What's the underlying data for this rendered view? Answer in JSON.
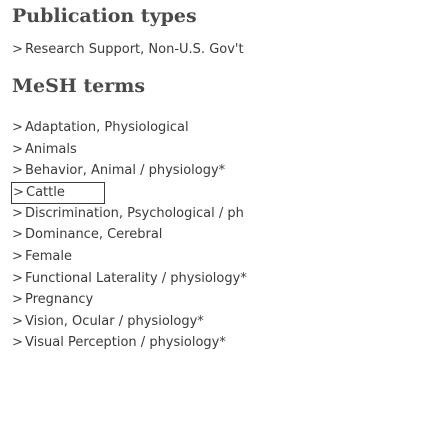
{
  "publication_types": {
    "heading": "Publication types",
    "items": [
      {
        "label": "Research Support, Non-U.S. Gov't"
      }
    ]
  },
  "mesh_terms": {
    "heading": "MeSH terms",
    "items": [
      {
        "label": "Adaptation, Physiological"
      },
      {
        "label": "Animals"
      },
      {
        "label": "Behavior, Animal / physiology*"
      },
      {
        "label": "Cattle"
      },
      {
        "label": "Discrimination, Psychological / ph"
      },
      {
        "label": "Dominance, Cerebral"
      },
      {
        "label": "Female"
      },
      {
        "label": "Functional Laterality / physiology*"
      },
      {
        "label": "Pregnancy"
      },
      {
        "label": "Vision, Ocular / physiology*"
      },
      {
        "label": "Visual Perception / physiology*"
      }
    ]
  },
  "chevron_glyph": ">"
}
